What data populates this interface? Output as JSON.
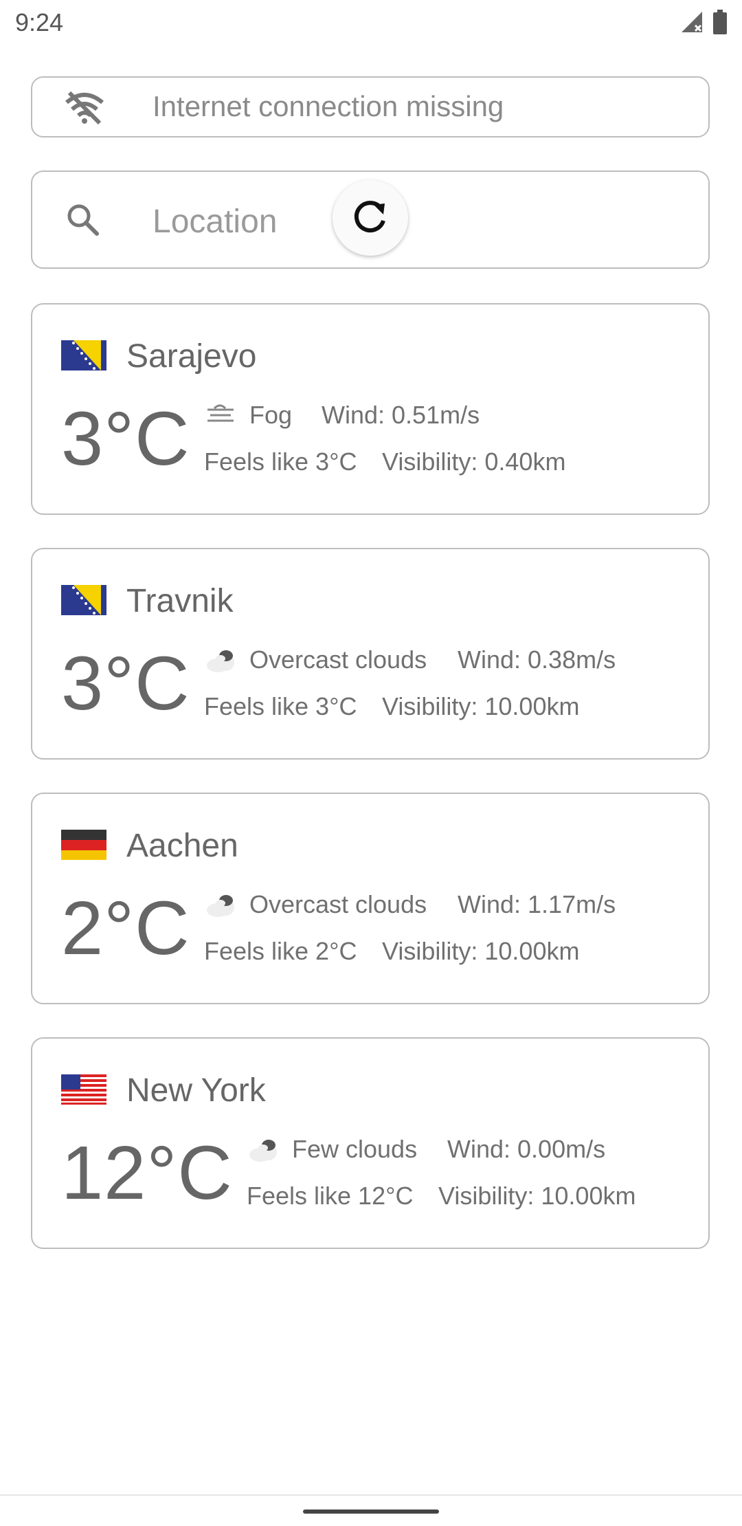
{
  "status": {
    "time": "9:24"
  },
  "banner": {
    "text": "Internet connection missing"
  },
  "search": {
    "placeholder": "Location"
  },
  "cards": [
    {
      "city": "Sarajevo",
      "flag": "bosnia",
      "temp": "3°C",
      "condition": "Fog",
      "condition_icon": "fog-icon",
      "wind": "Wind: 0.51m/s",
      "feels": "Feels like 3°C",
      "visibility": "Visibility: 0.40km"
    },
    {
      "city": "Travnik",
      "flag": "bosnia",
      "temp": "3°C",
      "condition": "Overcast clouds",
      "condition_icon": "cloud-icon",
      "wind": "Wind: 0.38m/s",
      "feels": "Feels like 3°C",
      "visibility": "Visibility: 10.00km"
    },
    {
      "city": "Aachen",
      "flag": "germany",
      "temp": "2°C",
      "condition": "Overcast clouds",
      "condition_icon": "cloud-icon",
      "wind": "Wind: 1.17m/s",
      "feels": "Feels like 2°C",
      "visibility": "Visibility: 10.00km"
    },
    {
      "city": "New York",
      "flag": "usa",
      "temp": "12°C",
      "condition": "Few clouds",
      "condition_icon": "cloud-icon",
      "wind": "Wind: 0.00m/s",
      "feels": "Feels like 12°C",
      "visibility": "Visibility: 10.00km"
    }
  ]
}
